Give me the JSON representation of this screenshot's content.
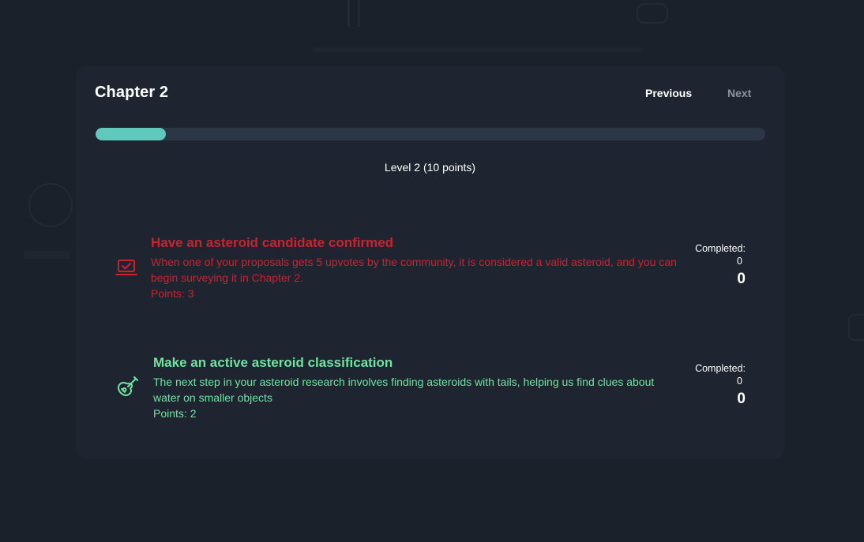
{
  "header": {
    "chapter_title": "Chapter 2",
    "previous_label": "Previous",
    "next_label": "Next"
  },
  "progress": {
    "fraction": 0.105
  },
  "level_label": "Level 2 (10 points)",
  "tasks": [
    {
      "icon": "laptop-check-icon",
      "title": "Have an asteroid candidate confirmed",
      "description": "When one of your proposals gets 5 upvotes by the community, it is considered a valid asteroid, and you can begin surveying it in Chapter 2.",
      "points": "Points: 3",
      "completed_label": "Completed:",
      "completed_count": "0",
      "completed_total": "0",
      "color": "#c8232f"
    },
    {
      "icon": "guitar-icon",
      "title": "Make an active asteroid classification",
      "description": "The next step in your asteroid research involves finding asteroids with tails, helping us find clues about water on smaller objects",
      "points": "Points: 2",
      "completed_label": "Completed:",
      "completed_count": "0",
      "completed_total": "0",
      "color": "#6fe3a0"
    }
  ]
}
